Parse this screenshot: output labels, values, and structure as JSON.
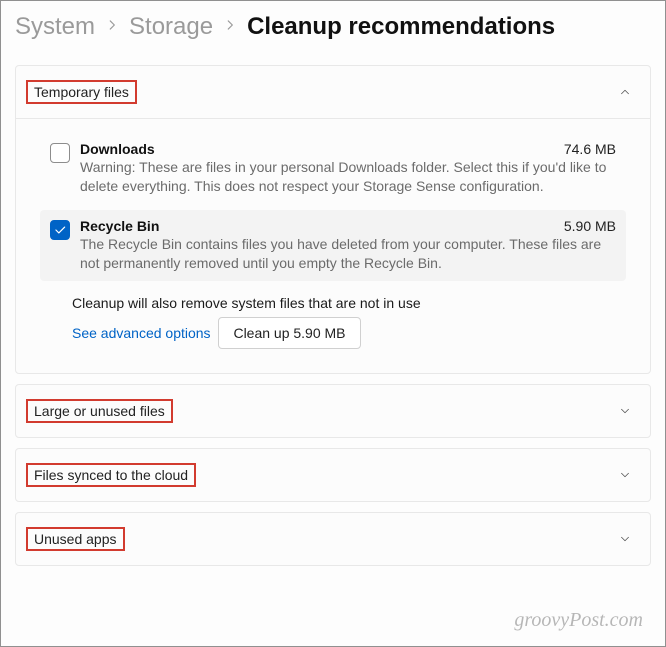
{
  "breadcrumb": {
    "system": "System",
    "storage": "Storage",
    "current": "Cleanup recommendations"
  },
  "sections": {
    "temporary": {
      "title": "Temporary files",
      "items": [
        {
          "title": "Downloads",
          "size": "74.6 MB",
          "desc": "Warning: These are files in your personal Downloads folder. Select this if you'd like to delete everything. This does not respect your Storage Sense configuration.",
          "checked": false
        },
        {
          "title": "Recycle Bin",
          "size": "5.90 MB",
          "desc": "The Recycle Bin contains files you have deleted from your computer. These files are not permanently removed until you empty the Recycle Bin.",
          "checked": true
        }
      ],
      "note": "Cleanup will also remove system files that are not in use",
      "advanced_link": "See advanced options",
      "cleanup_button": "Clean up 5.90 MB"
    },
    "large": {
      "title": "Large or unused files"
    },
    "cloud": {
      "title": "Files synced to the cloud"
    },
    "unused_apps": {
      "title": "Unused apps"
    }
  },
  "watermark": "groovyPost.com"
}
